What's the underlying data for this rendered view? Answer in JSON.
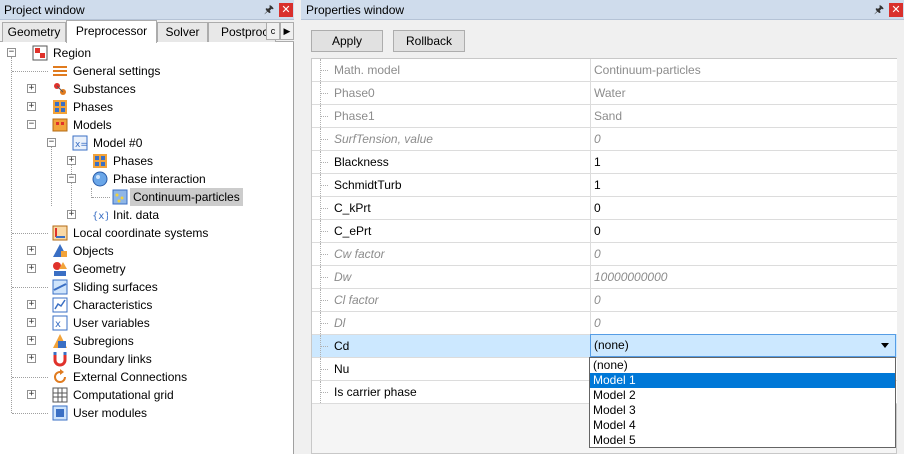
{
  "project_window": {
    "title": "Project window",
    "tabs": [
      "Geometry",
      "Preprocessor",
      "Solver",
      "Postproce"
    ],
    "tab_overflow": "c",
    "tree": {
      "root": "Region",
      "items": {
        "general_settings": "General settings",
        "substances": "Substances",
        "phases": "Phases",
        "models": "Models",
        "model0": "Model #0",
        "model_phases": "Phases",
        "phase_interaction": "Phase interaction",
        "continuum_particles": "Continuum-particles",
        "init_data": "Init. data",
        "local_coordinate_systems": "Local coordinate systems",
        "objects": "Objects",
        "geometry": "Geometry",
        "sliding_surfaces": "Sliding surfaces",
        "characteristics": "Characteristics",
        "user_variables": "User variables",
        "subregions": "Subregions",
        "boundary_links": "Boundary links",
        "external_connections": "External Connections",
        "computational_grid": "Computational grid",
        "user_modules": "User modules"
      }
    }
  },
  "properties_window": {
    "title": "Properties window",
    "buttons": {
      "apply": "Apply",
      "rollback": "Rollback"
    },
    "rows": [
      {
        "name": "Math. model",
        "value": "Continuum-particles"
      },
      {
        "name": "Phase0",
        "value": "Water"
      },
      {
        "name": "Phase1",
        "value": "Sand"
      },
      {
        "name": "SurfTension, value",
        "value": "0"
      },
      {
        "name": "Blackness",
        "value": "1"
      },
      {
        "name": "SchmidtTurb",
        "value": "1"
      },
      {
        "name": "C_kPrt",
        "value": "0"
      },
      {
        "name": "C_ePrt",
        "value": "0"
      },
      {
        "name": "Cw factor",
        "value": "0"
      },
      {
        "name": "Dw",
        "value": "10000000000"
      },
      {
        "name": "Cl factor",
        "value": "0"
      },
      {
        "name": "Dl",
        "value": "0"
      },
      {
        "name": "Cd",
        "value": "(none)"
      },
      {
        "name": "Nu",
        "value": ""
      },
      {
        "name": "Is carrier phase",
        "value": ""
      }
    ],
    "dropdown": {
      "selected": "Model 1",
      "options": [
        "(none)",
        "Model 1",
        "Model 2",
        "Model 3",
        "Model 4",
        "Model 5"
      ]
    }
  },
  "icons": {
    "pin": "pin-icon",
    "close": "close-icon",
    "tab_scroll_right": "arrow-right-icon"
  },
  "colors": {
    "title_bar": "#cfdcec",
    "close_button": "#d9302c",
    "selected_option": "#0078d7",
    "highlight_row": "#cce8ff"
  }
}
